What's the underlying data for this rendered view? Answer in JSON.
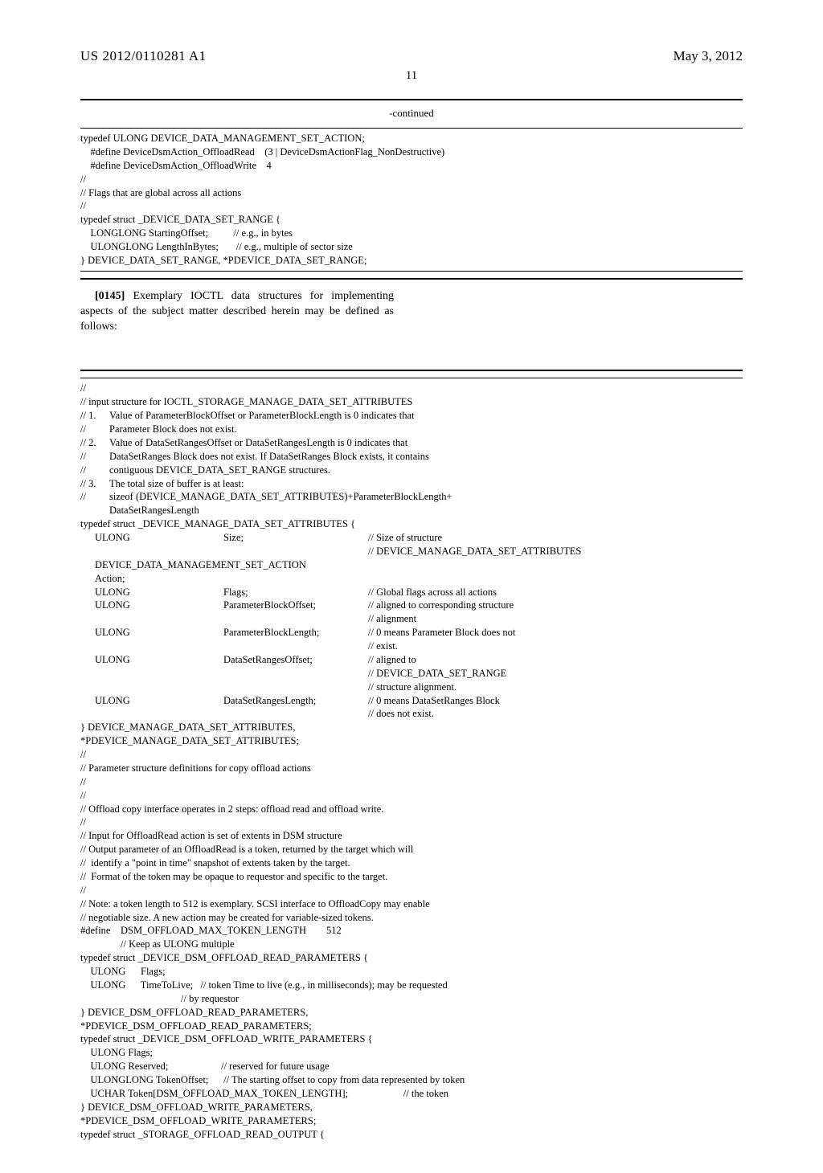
{
  "header": {
    "pub_number": "US 2012/0110281 A1",
    "pub_date": "May 3, 2012"
  },
  "page_number": "11",
  "continued_label": "-continued",
  "code_block_1": "typedef ULONG DEVICE_DATA_MANAGEMENT_SET_ACTION;\n    #define DeviceDsmAction_OffloadRead    (3 | DeviceDsmActionFlag_NonDestructive)\n    #define DeviceDsmAction_OffloadWrite    4\n//\n// Flags that are global across all actions\n//\ntypedef struct _DEVICE_DATA_SET_RANGE {\n    LONGLONG StartingOffset;          // e.g., in bytes\n    ULONGLONG LengthInBytes;       // e.g., multiple of sector size\n} DEVICE_DATA_SET_RANGE, *PDEVICE_DATA_SET_RANGE;",
  "paragraph": {
    "number": "[0145]",
    "text": "Exemplary IOCTL data structures for implementing aspects of the subject matter described herein may be defined as follows:"
  },
  "code2": {
    "lines": [
      "//",
      "// input structure for IOCTL_STORAGE_MANAGE_DATA_SET_ATTRIBUTES"
    ],
    "list": [
      {
        "n": "// 1.",
        "t": "Value of ParameterBlockOffset or ParameterBlockLength is 0 indicates that"
      },
      {
        "n": "//",
        "t": "Parameter Block does not exist."
      },
      {
        "n": "// 2.",
        "t": "Value of DataSetRangesOffset or DataSetRangesLength is 0 indicates that"
      },
      {
        "n": "//",
        "t": "DataSetRanges Block does not exist. If DataSetRanges Block exists, it contains"
      },
      {
        "n": "//",
        "t": "contiguous DEVICE_DATA_SET_RANGE structures."
      },
      {
        "n": "// 3.",
        "t": "The total size of buffer is at least:"
      },
      {
        "n": "//",
        "t": "sizeof (DEVICE_MANAGE_DATA_SET_ATTRIBUTES)+ParameterBlockLength+"
      },
      {
        "n": "",
        "t": "DataSetRangesLength"
      }
    ],
    "typedef_open": "typedef struct _DEVICE_MANAGE_DATA_SET_ATTRIBUTES {",
    "struct_members": [
      {
        "type": "ULONG",
        "name": "Size;",
        "comment": "// Size of structure",
        "comment2": "// DEVICE_MANAGE_DATA_SET_ATTRIBUTES"
      },
      {
        "type": "DEVICE_DATA_MANAGEMENT_SET_ACTION Action;",
        "name": "",
        "comment": ""
      },
      {
        "type": "ULONG",
        "name": "Flags;",
        "comment": "// Global flags across all actions"
      },
      {
        "type": "ULONG",
        "name": "ParameterBlockOffset;",
        "comment": "// aligned to corresponding structure",
        "comment2": "// alignment"
      },
      {
        "type": "ULONG",
        "name": "ParameterBlockLength;",
        "comment": "// 0 means Parameter Block does not",
        "comment2": "// exist."
      },
      {
        "type": "ULONG",
        "name": "DataSetRangesOffset;",
        "comment": "// aligned to",
        "comment2": "// DEVICE_DATA_SET_RANGE",
        "comment3": "// structure alignment."
      },
      {
        "type": "ULONG",
        "name": "DataSetRangesLength;",
        "comment": "// 0 means DataSetRanges Block",
        "comment2": "// does not exist."
      }
    ],
    "typedef_close": "} DEVICE_MANAGE_DATA_SET_ATTRIBUTES,\n*PDEVICE_MANAGE_DATA_SET_ATTRIBUTES;",
    "block_mid": "//\n// Parameter structure definitions for copy offload actions\n//\n//\n// Offload copy interface operates in 2 steps: offload read and offload write.\n//\n// Input for OffloadRead action is set of extents in DSM structure\n// Output parameter of an OffloadRead is a token, returned by the target which will\n//  identify a \"point in time\" snapshot of extents taken by the target.\n//  Format of the token may be opaque to requestor and specific to the target.\n//\n// Note: a token length to 512 is exemplary. SCSI interface to OffloadCopy may enable\n// negotiable size. A new action may be created for variable-sized tokens.\n#define    DSM_OFFLOAD_MAX_TOKEN_LENGTH        512\n                // Keep as ULONG multiple\ntypedef struct _DEVICE_DSM_OFFLOAD_READ_PARAMETERS {\n    ULONG      Flags;\n    ULONG      TimeToLive;   // token Time to live (e.g., in milliseconds); may be requested\n                                        // by requestor\n} DEVICE_DSM_OFFLOAD_READ_PARAMETERS,\n*PDEVICE_DSM_OFFLOAD_READ_PARAMETERS;\ntypedef struct _DEVICE_DSM_OFFLOAD_WRITE_PARAMETERS {\n    ULONG Flags;\n    ULONG Reserved;                     // reserved for future usage\n    ULONGLONG TokenOffset;      // The starting offset to copy from data represented by token\n    UCHAR Token[DSM_OFFLOAD_MAX_TOKEN_LENGTH];                      // the token\n} DEVICE_DSM_OFFLOAD_WRITE_PARAMETERS,\n*PDEVICE_DSM_OFFLOAD_WRITE_PARAMETERS;\ntypedef struct _STORAGE_OFFLOAD_READ_OUTPUT {"
  }
}
